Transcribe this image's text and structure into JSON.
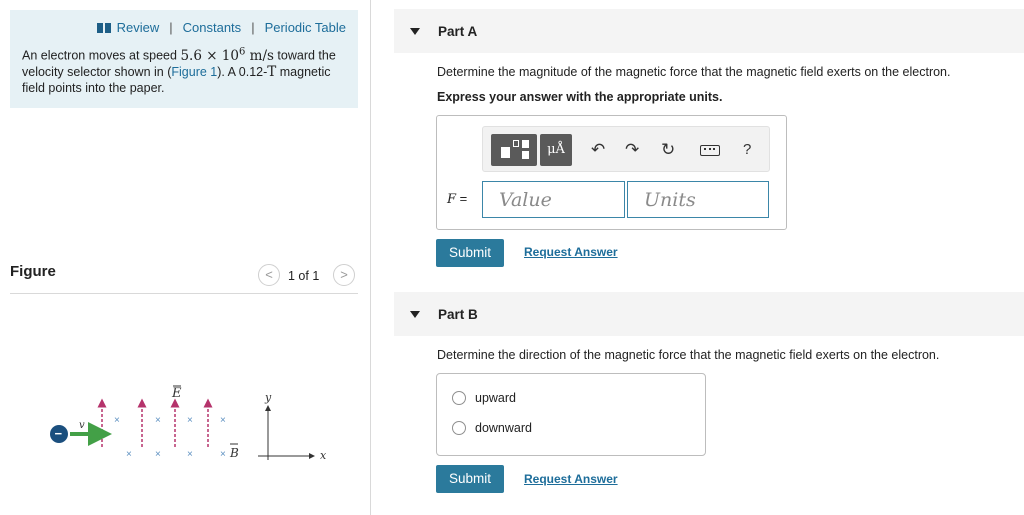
{
  "resources": {
    "review": "Review",
    "constants": "Constants",
    "periodic_table": "Periodic Table",
    "separator": "|"
  },
  "problem": {
    "text_1": "An electron moves at speed ",
    "speed": "5.6 × 10",
    "speed_exp": "6",
    "speed_units": "m/s",
    "text_2": " toward the velocity selector shown in (",
    "figure_link": "Figure 1",
    "text_3": "). A ",
    "field_value": "0.12-",
    "field_unit": "T",
    "text_4": " magnetic field points into the paper."
  },
  "figure": {
    "title": "Figure",
    "counter": "1 of 1",
    "prev": "<",
    "next": ">",
    "labels": {
      "e_vec": "E",
      "b_vec": "B",
      "v_vec": "v",
      "y_axis": "y",
      "x_axis": "x",
      "charge": "−",
      "cross": "×"
    },
    "colors": {
      "field_lines": "#b5336b",
      "cross": "#5b8fc0",
      "velocity": "#43a047",
      "electron": "#1b4f7e"
    }
  },
  "part_a": {
    "label": "Part A",
    "question": "Determine the magnitude of the magnetic force that the magnetic field exerts on the electron.",
    "hint": "Express your answer with the appropriate units.",
    "toolbar": {
      "units_button": "μÅ",
      "undo": "↶",
      "redo": "↷",
      "reset": "↻",
      "help": "?"
    },
    "variable": "F",
    "equals": " =",
    "value_placeholder": "Value",
    "units_placeholder": "Units",
    "submit": "Submit",
    "request_answer": "Request Answer"
  },
  "part_b": {
    "label": "Part B",
    "question": "Determine the direction of the magnetic force that the magnetic field exerts on the electron.",
    "options": [
      "upward",
      "downward"
    ],
    "submit": "Submit",
    "request_answer": "Request Answer"
  }
}
